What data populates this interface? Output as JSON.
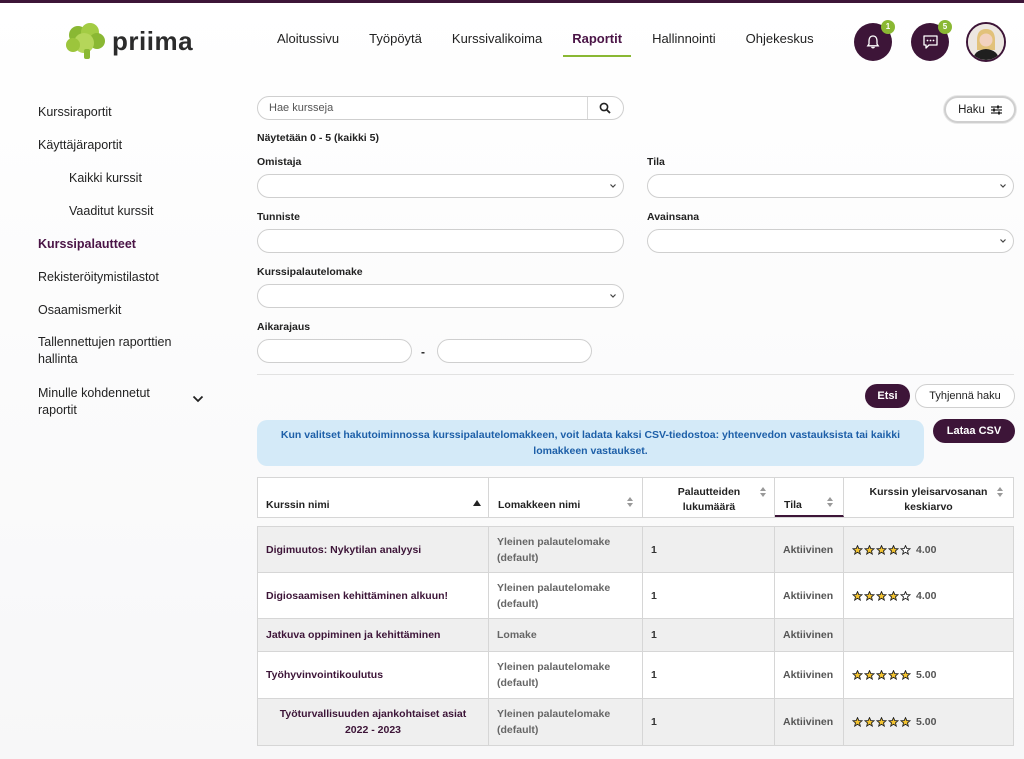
{
  "header": {
    "logo_text": "priima",
    "nav": [
      "Aloitussivu",
      "Työpöytä",
      "Kurssivalikoima",
      "Raportit",
      "Hallinnointi",
      "Ohjekeskus"
    ],
    "active_nav": "Raportit",
    "notifications_count": "1",
    "messages_count": "5"
  },
  "sidebar": {
    "items": [
      {
        "label": "Kurssiraportit"
      },
      {
        "label": "Käyttäjäraportit"
      },
      {
        "label": "Kaikki kurssit"
      },
      {
        "label": "Vaaditut kurssit"
      },
      {
        "label": "Kurssipalautteet"
      },
      {
        "label": "Rekisteröitymistilastot"
      },
      {
        "label": "Osaamismerkit"
      },
      {
        "label": "Tallennettujen raporttien hallinta"
      },
      {
        "label": "Minulle kohdennetut raportit"
      }
    ]
  },
  "search": {
    "placeholder": "Hae kursseja",
    "haku_label": "Haku"
  },
  "filters": {
    "showing": "Näytetään 0 - 5 (kaikki 5)",
    "owner_label": "Omistaja",
    "status_label": "Tila",
    "identifier_label": "Tunniste",
    "keyword_label": "Avainsana",
    "form_label": "Kurssipalautelomake",
    "timerange_label": "Aikarajaus",
    "range_separator": "-",
    "search_button": "Etsi",
    "clear_button": "Tyhjennä haku"
  },
  "info": {
    "text": "Kun valitset hakutoiminnossa kurssipalautelomakkeen, voit ladata kaksi CSV-tiedostoa: yhteenvedon vastauksista tai kaikki lomakkeen vastaukset.",
    "download_button": "Lataa CSV"
  },
  "table": {
    "headers": {
      "course": "Kurssin nimi",
      "form": "Lomakkeen nimi",
      "count": "Palautteiden lukumäärä",
      "status": "Tila",
      "rating": "Kurssin yleisarvosanan keskiarvo"
    },
    "rows": [
      {
        "course": "Digimuutos: Nykytilan analyysi",
        "form": "Yleinen palautelomake (default)",
        "count": "1",
        "status": "Aktiivinen",
        "rating": "4.00",
        "stars": 4
      },
      {
        "course": "Digiosaamisen kehittäminen alkuun!",
        "form": "Yleinen palautelomake (default)",
        "count": "1",
        "status": "Aktiivinen",
        "rating": "4.00",
        "stars": 4
      },
      {
        "course": "Jatkuva oppiminen ja kehittäminen",
        "form": "Lomake",
        "count": "1",
        "status": "Aktiivinen",
        "rating": "",
        "stars": 0
      },
      {
        "course": "Työhyvinvointikoulutus",
        "form": "Yleinen palautelomake (default)",
        "count": "1",
        "status": "Aktiivinen",
        "rating": "5.00",
        "stars": 5
      },
      {
        "course": "Työturvallisuuden ajankohtaiset asiat 2022 - 2023",
        "form": "Yleinen palautelomake (default)",
        "count": "1",
        "status": "Aktiivinen",
        "rating": "5.00",
        "stars": 5
      }
    ]
  },
  "colors": {
    "brand": "#3d1538",
    "accent": "#8ab833",
    "info_bg": "#d4eaf8",
    "info_text": "#1d5fa8"
  }
}
